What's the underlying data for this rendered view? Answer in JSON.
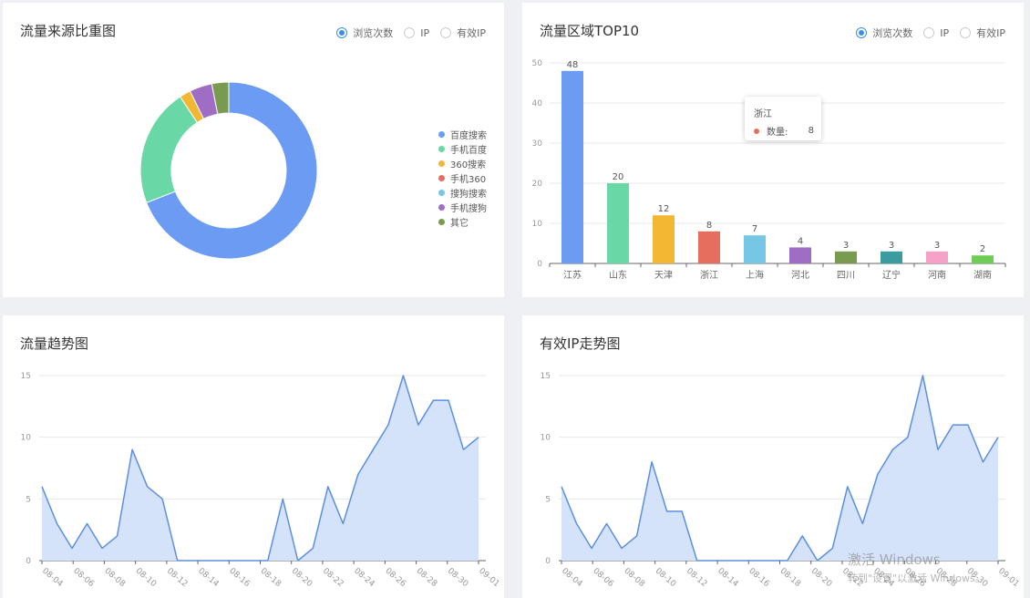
{
  "radio_options": [
    "浏览次数",
    "IP",
    "有效IP"
  ],
  "colors": {
    "accent": "#3a8ee6",
    "line": "#5b8fe0",
    "area": "#d4e2fa",
    "grid": "#e8e8e8",
    "axis": "#999999"
  },
  "panels": {
    "source": {
      "title": "流量来源比重图"
    },
    "region": {
      "title": "流量区域TOP10"
    },
    "trend": {
      "title": "流量趋势图"
    },
    "valid_ip": {
      "title": "有效IP走势图"
    }
  },
  "tooltip": {
    "title": "浙江",
    "label": "数量:",
    "value": "8",
    "dot_color": "#e66e5f"
  },
  "watermark": {
    "line1": "激活 Windows",
    "line2": "转到\"设置\"以激活 Windows。"
  },
  "chart_data": [
    {
      "type": "pie",
      "variant": "donut",
      "title": "流量来源比重图",
      "legend": "right",
      "slices": [
        {
          "name": "百度搜索",
          "value": 67,
          "color": "#6b9bf2"
        },
        {
          "name": "手机百度",
          "value": 21,
          "color": "#6ad8a6"
        },
        {
          "name": "360搜索",
          "value": 2,
          "color": "#f4b733"
        },
        {
          "name": "手机360",
          "value": 0,
          "color": "#e66e5f"
        },
        {
          "name": "搜狗搜索",
          "value": 0,
          "color": "#76c7e6"
        },
        {
          "name": "手机搜狗",
          "value": 4,
          "color": "#a06dc5"
        },
        {
          "name": "其它",
          "value": 3,
          "color": "#789b50"
        }
      ]
    },
    {
      "type": "bar",
      "title": "流量区域TOP10",
      "categories": [
        "江苏",
        "山东",
        "天津",
        "浙江",
        "上海",
        "河北",
        "四川",
        "辽宁",
        "河南",
        "湖南"
      ],
      "values": [
        48,
        20,
        12,
        8,
        7,
        4,
        3,
        3,
        3,
        2
      ],
      "colors": [
        "#6b9bf2",
        "#6ad8a6",
        "#f4b733",
        "#e66e5f",
        "#76c7e6",
        "#a06dc5",
        "#789b50",
        "#3a9c9f",
        "#f6a1c8",
        "#6fcd55"
      ],
      "yticks": [
        0,
        10,
        20,
        30,
        40,
        50
      ],
      "ylim": [
        0,
        50
      ],
      "grid": true
    },
    {
      "type": "area",
      "title": "流量趋势图",
      "x": [
        "08-04",
        "08-05",
        "08-06",
        "08-07",
        "08-08",
        "08-09",
        "08-10",
        "08-11",
        "08-12",
        "08-13",
        "08-14",
        "08-15",
        "08-16",
        "08-17",
        "08-18",
        "08-19",
        "08-20",
        "08-21",
        "08-22",
        "08-23",
        "08-24",
        "08-25",
        "08-26",
        "08-27",
        "08-28",
        "08-29",
        "08-30",
        "08-31",
        "09-01"
      ],
      "xtick_labels": [
        "08-04",
        "08-06",
        "08-08",
        "08-10",
        "08-12",
        "08-14",
        "08-16",
        "08-18",
        "08-20",
        "08-22",
        "08-24",
        "08-26",
        "08-28",
        "08-30",
        "09-01"
      ],
      "values": [
        6,
        3,
        1,
        3,
        1,
        2,
        9,
        6,
        5,
        0,
        0,
        0,
        0,
        0,
        0,
        0,
        5,
        0,
        1,
        6,
        3,
        7,
        9,
        11,
        15,
        11,
        13,
        13,
        9,
        10
      ],
      "yticks": [
        0,
        5,
        10,
        15
      ],
      "ylim": [
        0,
        15
      ],
      "grid": true
    },
    {
      "type": "area",
      "title": "有效IP走势图",
      "x": [
        "08-04",
        "08-05",
        "08-06",
        "08-07",
        "08-08",
        "08-09",
        "08-10",
        "08-11",
        "08-12",
        "08-13",
        "08-14",
        "08-15",
        "08-16",
        "08-17",
        "08-18",
        "08-19",
        "08-20",
        "08-21",
        "08-22",
        "08-23",
        "08-24",
        "08-25",
        "08-26",
        "08-27",
        "08-28",
        "08-29",
        "08-30",
        "08-31",
        "09-01"
      ],
      "xtick_labels": [
        "08-04",
        "08-06",
        "08-08",
        "08-10",
        "08-12",
        "08-14",
        "08-16",
        "08-18",
        "08-20",
        "08-22",
        "08-24",
        "08-26",
        "08-28",
        "08-30",
        "09-01"
      ],
      "values": [
        6,
        3,
        1,
        3,
        1,
        2,
        8,
        4,
        4,
        0,
        0,
        0,
        0,
        0,
        0,
        0,
        2,
        0,
        1,
        6,
        3,
        7,
        9,
        10,
        15,
        9,
        11,
        11,
        8,
        10
      ],
      "yticks": [
        0,
        5,
        10,
        15
      ],
      "ylim": [
        0,
        15
      ],
      "grid": true
    }
  ]
}
